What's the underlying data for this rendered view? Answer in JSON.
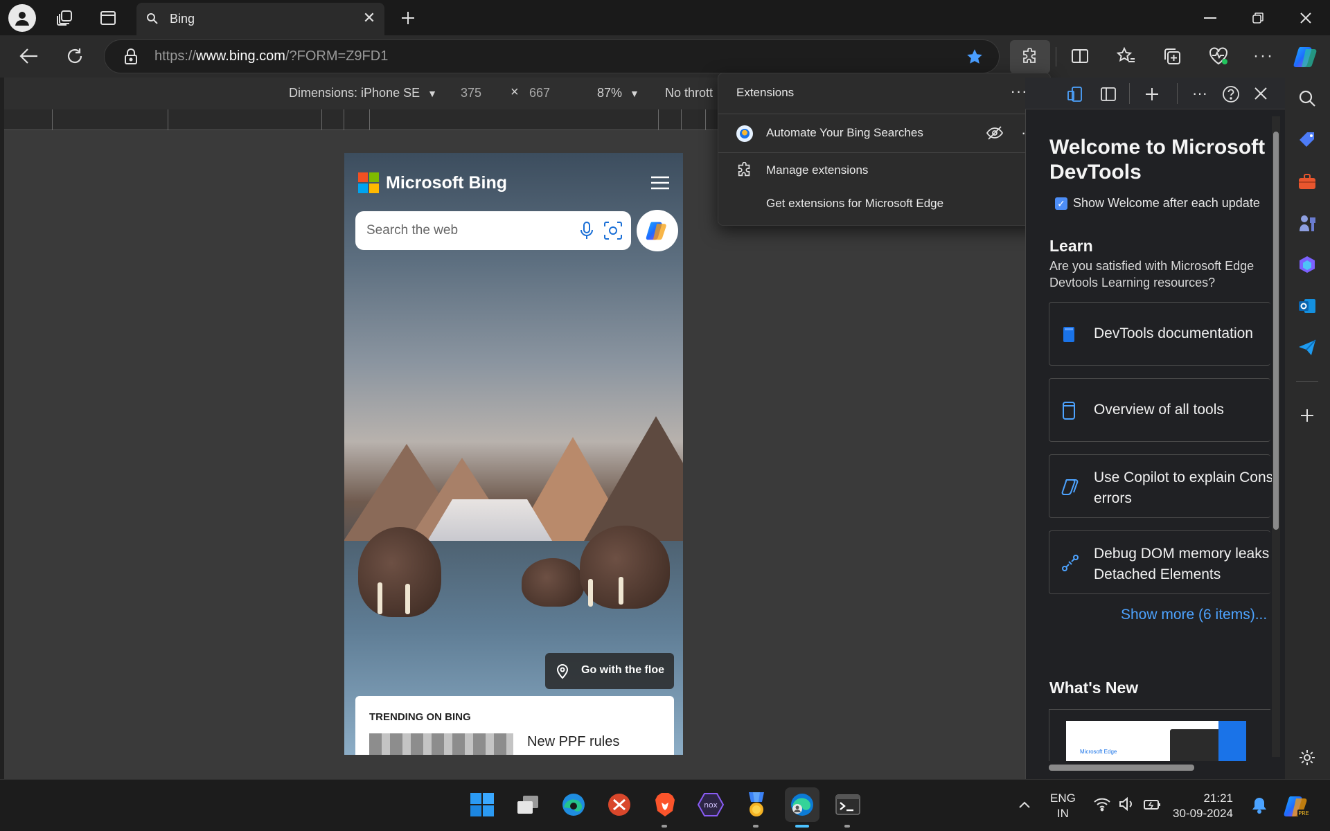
{
  "tab": {
    "title": "Bing"
  },
  "address": {
    "scheme": "https://",
    "host": "www.bing.com",
    "path": "/?FORM=Z9FD1"
  },
  "device_toolbar": {
    "dimensions_label": "Dimensions: iPhone SE",
    "width": "375",
    "times": "×",
    "height": "667",
    "zoom": "87%",
    "throttle": "No thrott"
  },
  "bing": {
    "brand": "Microsoft Bing",
    "search_placeholder": "Search the web",
    "location_label": "Go with the floe",
    "trending_header": "TRENDING ON BING",
    "trending_item": "New PPF rules"
  },
  "extensions_popup": {
    "title": "Extensions",
    "item_name": "Automate Your Bing Searches",
    "manage": "Manage extensions",
    "get_more": "Get extensions for Microsoft Edge"
  },
  "devtools": {
    "welcome_title_line1": "Welcome to Microsoft I",
    "welcome_title_line2": "DevTools",
    "show_welcome": "Show Welcome after each update",
    "learn_heading": "Learn",
    "learn_sub": "Are you satisfied with Microsoft Edge Devtools Learning resources?",
    "cards": [
      {
        "line1": "DevTools documentation",
        "line2": ""
      },
      {
        "line1": "Overview of all tools",
        "line2": ""
      },
      {
        "line1": "Use Copilot to explain Cons",
        "line2": "errors"
      },
      {
        "line1": "Debug DOM memory leaks",
        "line2": "Detached Elements"
      }
    ],
    "show_more": "Show more (6 items)...",
    "whats_new": "What's New",
    "thumb_caption": "Microsoft Edge"
  },
  "taskbar": {
    "lang1": "ENG",
    "lang2": "IN",
    "time": "21:21",
    "date": "30-09-2024"
  },
  "colors": {
    "accent": "#0078d4",
    "link": "#4da3ff"
  }
}
